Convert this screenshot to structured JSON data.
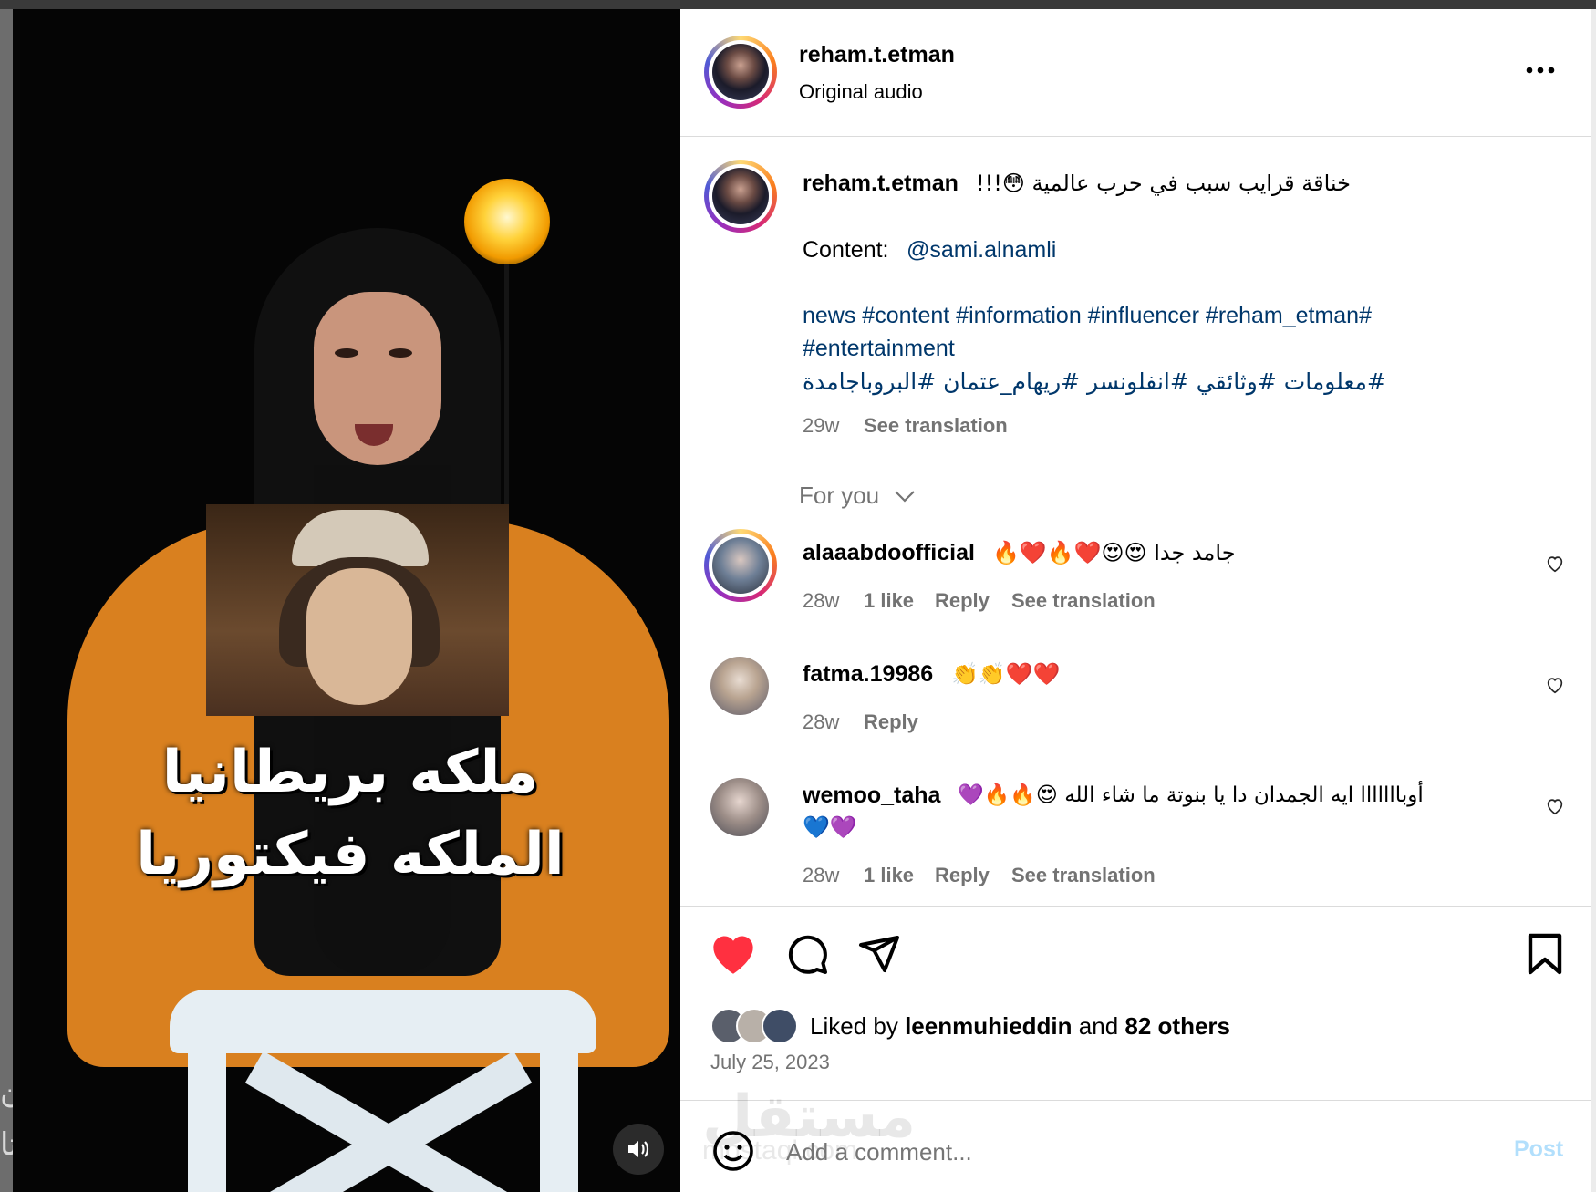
{
  "left_side": {
    "text1": "تن",
    "text2": "انتا"
  },
  "video": {
    "caption_line1": "ملكه بريطانيا",
    "caption_line2": "الملكه فيكتوريا",
    "mute_icon": "speaker-icon"
  },
  "header": {
    "username": "reham.t.etman",
    "subtitle": "Original audio",
    "more_icon": "more-options-icon"
  },
  "post": {
    "username": "reham.t.etman",
    "caption_rtl": "خناقة قرايب سبب في حرب عالمية 😳!!!",
    "content_label": "Content:",
    "content_mention": "@sami.alnamli",
    "hashtags_line1": "news #content #information #influencer #reham_etman#",
    "hashtags_line2": "#entertainment",
    "hashtags_line3": "#معلومات #وثائقي #انفلونسر #ريهام_عتمان #البروباجامدة",
    "time": "29w",
    "see_translation": "See translation"
  },
  "sort": {
    "label": "For you"
  },
  "comments": [
    {
      "username": "alaaabdoofficial",
      "text": "جامد جدا 😍😍❤️🔥❤️🔥",
      "time": "28w",
      "likes": "1 like",
      "reply": "Reply",
      "see_translation": "See translation"
    },
    {
      "username": "fatma.19986",
      "text": "👏👏❤️❤️",
      "time": "28w",
      "reply": "Reply"
    },
    {
      "username": "wemoo_taha",
      "text": "أوبااااااا ايه الجمدان دا يا بنوتة ما شاء الله 😍🔥🔥💜",
      "text_line2": "💙💜",
      "time": "28w",
      "likes": "1 like",
      "reply": "Reply",
      "see_translation": "See translation"
    }
  ],
  "actions": {
    "like_icon": "heart-filled-icon",
    "comment_icon": "comment-icon",
    "share_icon": "share-icon",
    "save_icon": "bookmark-icon"
  },
  "likes": {
    "prefix": "Liked by",
    "user": "leenmuhieddin",
    "and": "and",
    "others": "82 others"
  },
  "date": "July 25, 2023",
  "add_comment": {
    "placeholder": "Add a comment...",
    "post_label": "Post",
    "emoji_icon": "emoji-icon"
  },
  "watermark": {
    "line1": "مستقل",
    "line2": "mostaql.com"
  },
  "colors": {
    "like_red": "#ff3040",
    "link_blue": "#00376b",
    "muted": "#737373",
    "post_disabled": "#b2dffc"
  }
}
